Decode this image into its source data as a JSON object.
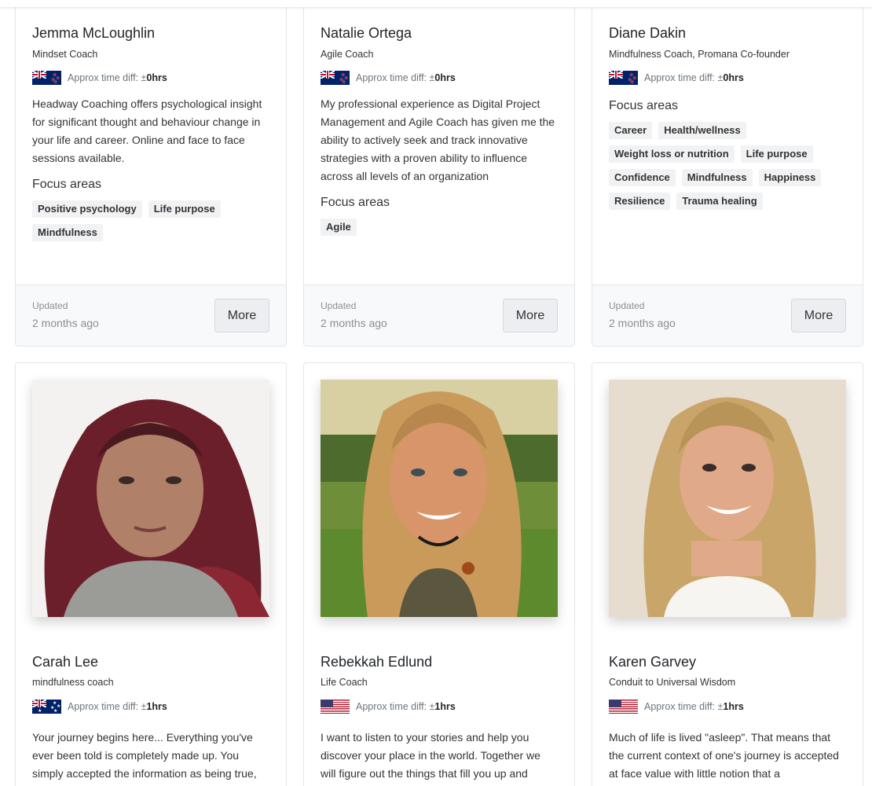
{
  "tz_prefix": "Approx time diff: ±",
  "tz_unit": " hrs",
  "focus_heading": "Focus areas",
  "updated_label": "Updated",
  "more_label": "More",
  "top_cards": [
    {
      "name": "Jemma McLoughlin",
      "title": "Mindset Coach",
      "flag": "nz-flag",
      "tz": "0",
      "bio": "Headway Coaching offers psychological insight for significant thought and behaviour change in your life and career. Online and face to face sessions available.",
      "tags": [
        "Positive psychology",
        "Life purpose",
        "Mindfulness"
      ],
      "updated": "2 months ago"
    },
    {
      "name": "Natalie Ortega",
      "title": "Agile Coach",
      "flag": "nz-flag",
      "tz": "0",
      "bio": "My professional experience as Digital Project Management and Agile Coach has given me the ability to actively seek and track innovative strategies with a proven ability to influence across all levels of an organization",
      "tags": [
        "Agile"
      ],
      "updated": "2 months ago"
    },
    {
      "name": "Diane Dakin",
      "title": "Mindfulness Coach, Promana Co-founder",
      "flag": "nz-flag",
      "tz": "0",
      "bio": "",
      "tags": [
        "Career",
        "Health/wellness",
        "Weight loss or nutrition",
        "Life purpose",
        "Confidence",
        "Mindfulness",
        "Happiness",
        "Resilience",
        "Trauma healing"
      ],
      "updated": "2 months ago"
    }
  ],
  "bottom_cards": [
    {
      "name": "Carah Lee",
      "title": "mindfulness coach",
      "flag": "au-flag",
      "tz": "1",
      "bio": "Your journey begins here... Everything you've ever been told is completely made up. You simply accepted the information as being true,"
    },
    {
      "name": "Rebekkah Edlund",
      "title": "Life Coach",
      "flag": "us-flag",
      "tz": "1",
      "bio": "I want to listen to your stories and help you discover your place in the world. Together we will figure out the things that fill you up and"
    },
    {
      "name": "Karen Garvey",
      "title": "Conduit to Universal Wisdom",
      "flag": "us-flag",
      "tz": "1",
      "bio": "Much of life is lived \"asleep\". That means that the current context of one's journey is accepted at face value with little notion that a"
    }
  ]
}
